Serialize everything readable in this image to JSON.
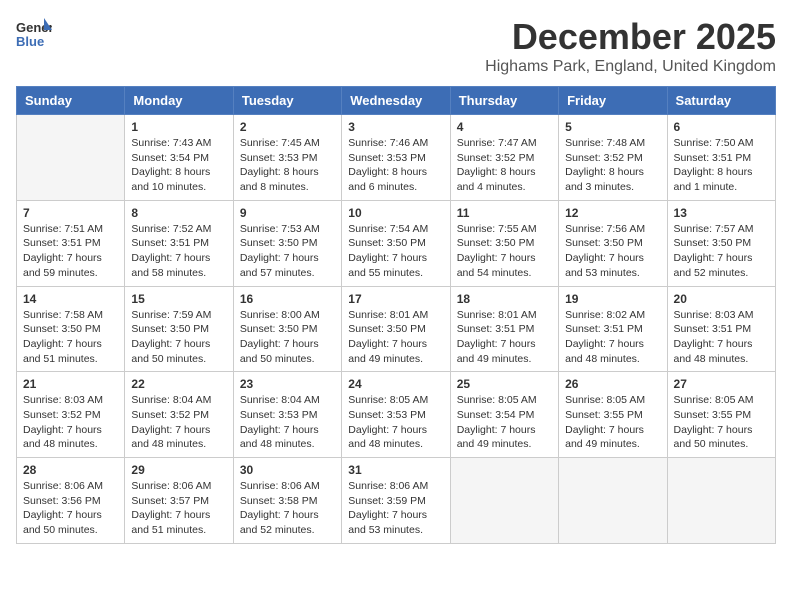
{
  "header": {
    "logo_line1": "General",
    "logo_line2": "Blue",
    "month_title": "December 2025",
    "location": "Highams Park, England, United Kingdom"
  },
  "days_of_week": [
    "Sunday",
    "Monday",
    "Tuesday",
    "Wednesday",
    "Thursday",
    "Friday",
    "Saturday"
  ],
  "weeks": [
    [
      {
        "day": "",
        "info": ""
      },
      {
        "day": "1",
        "info": "Sunrise: 7:43 AM\nSunset: 3:54 PM\nDaylight: 8 hours\nand 10 minutes."
      },
      {
        "day": "2",
        "info": "Sunrise: 7:45 AM\nSunset: 3:53 PM\nDaylight: 8 hours\nand 8 minutes."
      },
      {
        "day": "3",
        "info": "Sunrise: 7:46 AM\nSunset: 3:53 PM\nDaylight: 8 hours\nand 6 minutes."
      },
      {
        "day": "4",
        "info": "Sunrise: 7:47 AM\nSunset: 3:52 PM\nDaylight: 8 hours\nand 4 minutes."
      },
      {
        "day": "5",
        "info": "Sunrise: 7:48 AM\nSunset: 3:52 PM\nDaylight: 8 hours\nand 3 minutes."
      },
      {
        "day": "6",
        "info": "Sunrise: 7:50 AM\nSunset: 3:51 PM\nDaylight: 8 hours\nand 1 minute."
      }
    ],
    [
      {
        "day": "7",
        "info": "Sunrise: 7:51 AM\nSunset: 3:51 PM\nDaylight: 7 hours\nand 59 minutes."
      },
      {
        "day": "8",
        "info": "Sunrise: 7:52 AM\nSunset: 3:51 PM\nDaylight: 7 hours\nand 58 minutes."
      },
      {
        "day": "9",
        "info": "Sunrise: 7:53 AM\nSunset: 3:50 PM\nDaylight: 7 hours\nand 57 minutes."
      },
      {
        "day": "10",
        "info": "Sunrise: 7:54 AM\nSunset: 3:50 PM\nDaylight: 7 hours\nand 55 minutes."
      },
      {
        "day": "11",
        "info": "Sunrise: 7:55 AM\nSunset: 3:50 PM\nDaylight: 7 hours\nand 54 minutes."
      },
      {
        "day": "12",
        "info": "Sunrise: 7:56 AM\nSunset: 3:50 PM\nDaylight: 7 hours\nand 53 minutes."
      },
      {
        "day": "13",
        "info": "Sunrise: 7:57 AM\nSunset: 3:50 PM\nDaylight: 7 hours\nand 52 minutes."
      }
    ],
    [
      {
        "day": "14",
        "info": "Sunrise: 7:58 AM\nSunset: 3:50 PM\nDaylight: 7 hours\nand 51 minutes."
      },
      {
        "day": "15",
        "info": "Sunrise: 7:59 AM\nSunset: 3:50 PM\nDaylight: 7 hours\nand 50 minutes."
      },
      {
        "day": "16",
        "info": "Sunrise: 8:00 AM\nSunset: 3:50 PM\nDaylight: 7 hours\nand 50 minutes."
      },
      {
        "day": "17",
        "info": "Sunrise: 8:01 AM\nSunset: 3:50 PM\nDaylight: 7 hours\nand 49 minutes."
      },
      {
        "day": "18",
        "info": "Sunrise: 8:01 AM\nSunset: 3:51 PM\nDaylight: 7 hours\nand 49 minutes."
      },
      {
        "day": "19",
        "info": "Sunrise: 8:02 AM\nSunset: 3:51 PM\nDaylight: 7 hours\nand 48 minutes."
      },
      {
        "day": "20",
        "info": "Sunrise: 8:03 AM\nSunset: 3:51 PM\nDaylight: 7 hours\nand 48 minutes."
      }
    ],
    [
      {
        "day": "21",
        "info": "Sunrise: 8:03 AM\nSunset: 3:52 PM\nDaylight: 7 hours\nand 48 minutes."
      },
      {
        "day": "22",
        "info": "Sunrise: 8:04 AM\nSunset: 3:52 PM\nDaylight: 7 hours\nand 48 minutes."
      },
      {
        "day": "23",
        "info": "Sunrise: 8:04 AM\nSunset: 3:53 PM\nDaylight: 7 hours\nand 48 minutes."
      },
      {
        "day": "24",
        "info": "Sunrise: 8:05 AM\nSunset: 3:53 PM\nDaylight: 7 hours\nand 48 minutes."
      },
      {
        "day": "25",
        "info": "Sunrise: 8:05 AM\nSunset: 3:54 PM\nDaylight: 7 hours\nand 49 minutes."
      },
      {
        "day": "26",
        "info": "Sunrise: 8:05 AM\nSunset: 3:55 PM\nDaylight: 7 hours\nand 49 minutes."
      },
      {
        "day": "27",
        "info": "Sunrise: 8:05 AM\nSunset: 3:55 PM\nDaylight: 7 hours\nand 50 minutes."
      }
    ],
    [
      {
        "day": "28",
        "info": "Sunrise: 8:06 AM\nSunset: 3:56 PM\nDaylight: 7 hours\nand 50 minutes."
      },
      {
        "day": "29",
        "info": "Sunrise: 8:06 AM\nSunset: 3:57 PM\nDaylight: 7 hours\nand 51 minutes."
      },
      {
        "day": "30",
        "info": "Sunrise: 8:06 AM\nSunset: 3:58 PM\nDaylight: 7 hours\nand 52 minutes."
      },
      {
        "day": "31",
        "info": "Sunrise: 8:06 AM\nSunset: 3:59 PM\nDaylight: 7 hours\nand 53 minutes."
      },
      {
        "day": "",
        "info": ""
      },
      {
        "day": "",
        "info": ""
      },
      {
        "day": "",
        "info": ""
      }
    ]
  ]
}
